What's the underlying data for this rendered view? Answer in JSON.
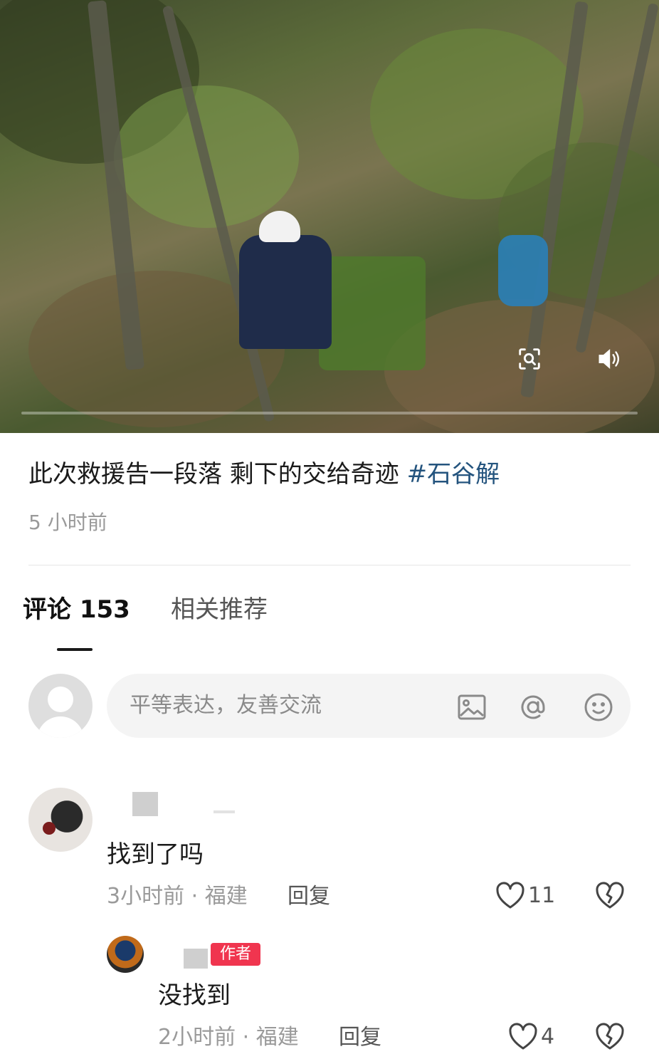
{
  "post": {
    "caption": "此次救援告一段落  剩下的交给奇迹 ",
    "hashtag": "#石谷解",
    "time": "5 小时前"
  },
  "video": {
    "zoom_icon": "lens-search-icon",
    "volume_icon": "speaker-volume-icon"
  },
  "tabs": {
    "comments": "评论 153",
    "related": "相关推荐"
  },
  "comment_input": {
    "placeholder": "平等表达，友善交流",
    "icons": [
      "image-icon",
      "at-icon",
      "emoji-icon"
    ]
  },
  "comments": [
    {
      "text": "找到了吗",
      "time": "3小时前",
      "location": "福建",
      "reply_label": "回复",
      "likes": "11"
    },
    {
      "author_badge": "作者",
      "text": "没找到",
      "time": "2小时前",
      "location": "福建",
      "reply_label": "回复",
      "likes": "4"
    }
  ],
  "meta_separator": "·"
}
